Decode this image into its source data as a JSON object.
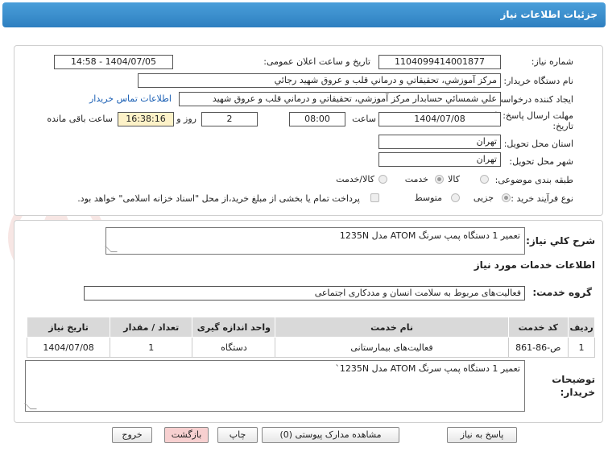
{
  "header": {
    "title": "جزئیات اطلاعات نیاز"
  },
  "watermark": {
    "text": "AriaTender.net"
  },
  "form": {
    "need_number_label": "شماره نیاز:",
    "need_number": "1104099414001877",
    "announce_label": "تاریخ و ساعت اعلان عمومی:",
    "announce_value": "1404/07/05 - 14:58",
    "buyer_label": "نام دستگاه خریدار:",
    "buyer_value": "مرکز آموزشي، تحقيقاتي و درماني قلب و عروق شهيد رجائي",
    "creator_label": "ایجاد کننده درخواست:",
    "creator_value": "علي شمسائي حسابدار مرکز آموزشي، تحقيقاتي و درماني قلب و عروق شهيد",
    "contact_link": "اطلاعات تماس خریدار",
    "deadline_label_1": "مهلت ارسال پاسخ: تا",
    "deadline_label_2": "تاریخ:",
    "deadline_date": "1404/07/08",
    "time_label": "ساعت",
    "deadline_time": "08:00",
    "days_value": "2",
    "days_label": "روز و",
    "remaining_time": "16:38:16",
    "remaining_label": "ساعت باقی مانده",
    "province_label": "استان محل تحویل:",
    "province_value": "تهران",
    "city_label": "شهر محل تحویل:",
    "city_value": "تهران",
    "category_label": "طبقه بندی موضوعی:",
    "category_options": [
      "کالا",
      "خدمت",
      "کالا/خدمت"
    ],
    "category_selected": "خدمت",
    "process_label": "نوع فرآیند خرید :",
    "process_options": [
      "جزیی",
      "متوسط"
    ],
    "process_selected": "جزیی",
    "payment_note": "پرداخت تمام یا بخشی از مبلغ خرید،از محل \"اسناد خزانه اسلامی\" خواهد بود."
  },
  "summary": {
    "label": "شرح کلي نياز:",
    "value": "تعمير 1 دستگاه پمپ سرنگ ATOM مدل 1235N"
  },
  "services": {
    "section_title": "اطلاعات خدمات مورد نیاز",
    "group_label": "گروه خدمت:",
    "group_value": "فعالیت‌های مربوط به سلامت انسان و مددکاری اجتماعی",
    "columns": [
      "ردیف",
      "کد خدمت",
      "نام خدمت",
      "واحد اندازه گیری",
      "تعداد / مقدار",
      "تاریخ نیاز"
    ],
    "rows": [
      {
        "row": "1",
        "code": "ص-86-861",
        "name": "فعالیت‌های بیمارستانی",
        "unit": "دستگاه",
        "qty": "1",
        "date": "1404/07/08"
      }
    ]
  },
  "buyer_notes": {
    "label_1": "توضیحات",
    "label_2": "خریدار:",
    "value": "تعمير 1 دستگاه پمپ سرنگ ATOM مدل 1235N`"
  },
  "buttons": {
    "reply": "پاسخ به نیاز",
    "attachments": "مشاهده مدارک پیوستی (0)",
    "print": "چاپ",
    "back": "بازگشت",
    "exit": "خروج"
  }
}
